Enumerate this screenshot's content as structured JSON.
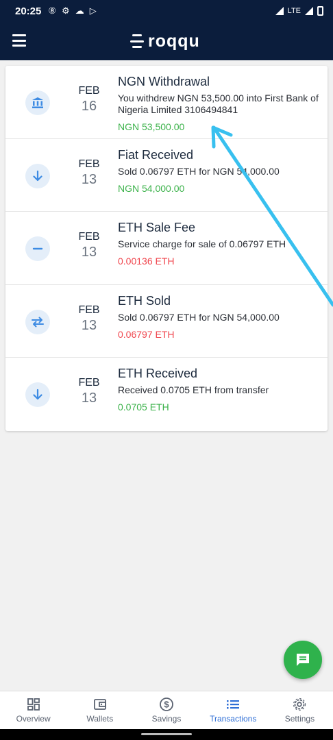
{
  "status_bar": {
    "time": "20:25",
    "network": "LTE"
  },
  "app_bar": {
    "menu_icon": "hamburger-menu-icon",
    "brand": "roqqu"
  },
  "transactions": [
    {
      "icon": "bank-icon",
      "month": "FEB",
      "day": "16",
      "title": "NGN Withdrawal",
      "description": "You withdrew NGN 53,500.00 into First Bank of Nigeria Limited 3106494841",
      "amount": "NGN 53,500.00",
      "amount_color": "#3bb24a"
    },
    {
      "icon": "arrow-down-icon",
      "month": "FEB",
      "day": "13",
      "title": "Fiat Received",
      "description": "Sold 0.06797 ETH for NGN 54,000.00",
      "amount": "NGN 54,000.00",
      "amount_color": "#3bb24a"
    },
    {
      "icon": "minus-icon",
      "month": "FEB",
      "day": "13",
      "title": "ETH Sale Fee",
      "description": "Service charge for sale of 0.06797 ETH",
      "amount": "0.00136 ETH",
      "amount_color": "#f0464e"
    },
    {
      "icon": "swap-icon",
      "month": "FEB",
      "day": "13",
      "title": "ETH Sold",
      "description": "Sold 0.06797 ETH for NGN 54,000.00",
      "amount": "0.06797 ETH",
      "amount_color": "#f0464e"
    },
    {
      "icon": "arrow-down-icon",
      "month": "FEB",
      "day": "13",
      "title": "ETH Received",
      "description": "Received 0.0705 ETH from transfer",
      "amount": "0.0705 ETH",
      "amount_color": "#3bb24a"
    }
  ],
  "fab": {
    "icon": "chat-icon"
  },
  "bottom_nav": [
    {
      "label": "Overview",
      "icon": "dashboard-icon"
    },
    {
      "label": "Wallets",
      "icon": "wallet-icon"
    },
    {
      "label": "Savings",
      "icon": "dollar-circle-icon"
    },
    {
      "label": "Transactions",
      "icon": "list-icon",
      "active": true
    },
    {
      "label": "Settings",
      "icon": "gear-icon"
    }
  ],
  "colors": {
    "header_bg": "#0b1d3c",
    "accent": "#2f6fd6",
    "positive": "#3bb24a",
    "negative": "#f0464e",
    "fab": "#2fb24c",
    "annotation_arrow": "#38c0ef"
  }
}
